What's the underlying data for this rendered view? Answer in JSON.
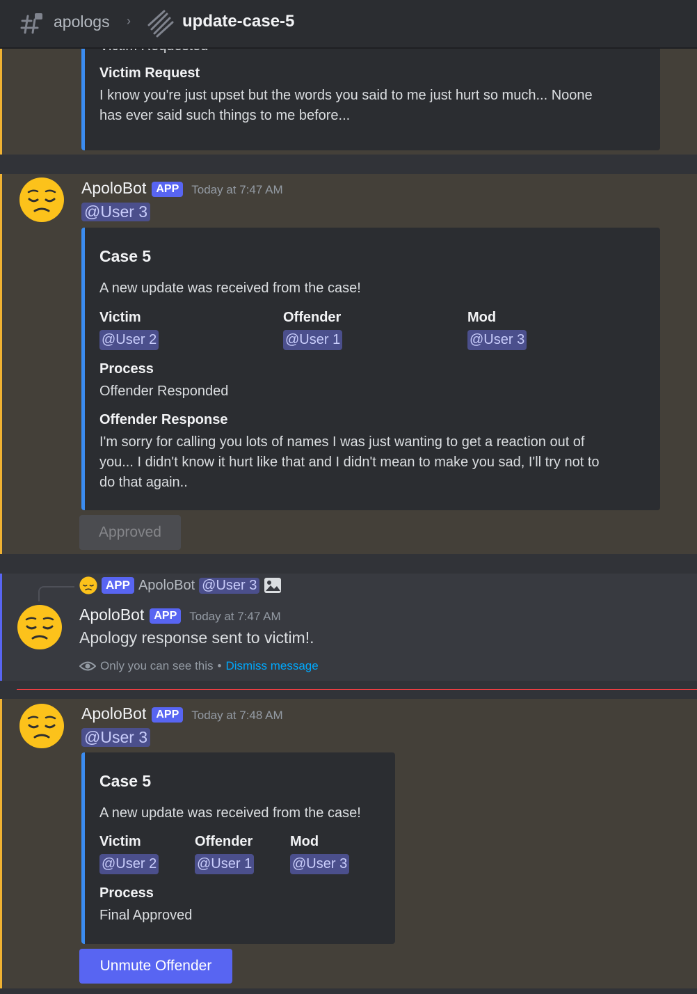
{
  "header": {
    "parent_channel": "apologs",
    "thread_name": "update-case-5"
  },
  "top_embed": {
    "partial_value": "Victim Requested",
    "field_name": "Victim Request",
    "field_value_line1": "I know you're just upset but the words you said to me just hurt so much... Noone",
    "field_value_line2": "has ever said such things to me before..."
  },
  "message1": {
    "author": "ApoloBot",
    "app_tag": "APP",
    "timestamp": "Today at 7:47 AM",
    "mention": "@User 3",
    "embed": {
      "title": "Case 5",
      "description": "A new update was received from the case!",
      "fields": [
        {
          "name": "Victim",
          "value": "@User 2"
        },
        {
          "name": "Offender",
          "value": "@User 1"
        },
        {
          "name": "Mod",
          "value": "@User 3"
        },
        {
          "name": "Process",
          "value": "Offender Responded"
        },
        {
          "name": "Offender Response",
          "value_lines": [
            "I'm sorry for calling you lots of names I was just wanting to get a reaction out of",
            "you... I didn't know it hurt like that and I didn't mean to make you sad, I'll try not to",
            "do that again.."
          ]
        }
      ]
    },
    "button_label": "Approved"
  },
  "message2": {
    "reply": {
      "app_tag": "APP",
      "author": "ApoloBot",
      "mention": "@User 3"
    },
    "author": "ApoloBot",
    "app_tag": "APP",
    "timestamp": "Today at 7:47 AM",
    "text": "Apology response sent to victim!.",
    "ephemeral_note": "Only you can see this",
    "separator": "•",
    "dismiss_label": "Dismiss message"
  },
  "message3": {
    "author": "ApoloBot",
    "app_tag": "APP",
    "timestamp": "Today at 7:48 AM",
    "mention": "@User 3",
    "embed": {
      "title": "Case 5",
      "description": "A new update was received from the case!",
      "fields": [
        {
          "name": "Victim",
          "value": "@User 2"
        },
        {
          "name": "Offender",
          "value": "@User 1"
        },
        {
          "name": "Mod",
          "value": "@User 3"
        },
        {
          "name": "Process",
          "value": "Final Approved"
        }
      ]
    },
    "button_label": "Unmute Offender"
  },
  "colors": {
    "accent": "#5865f2",
    "embed_bar": "#3b8cf0",
    "mention_highlight": "#f0b232",
    "new_divider": "#f23f43",
    "link": "#00a8fc"
  },
  "icons": [
    "thread-hash-icon",
    "chevron-right-icon",
    "thread-icon",
    "pensive-face-avatar",
    "eye-icon",
    "image-icon"
  ]
}
